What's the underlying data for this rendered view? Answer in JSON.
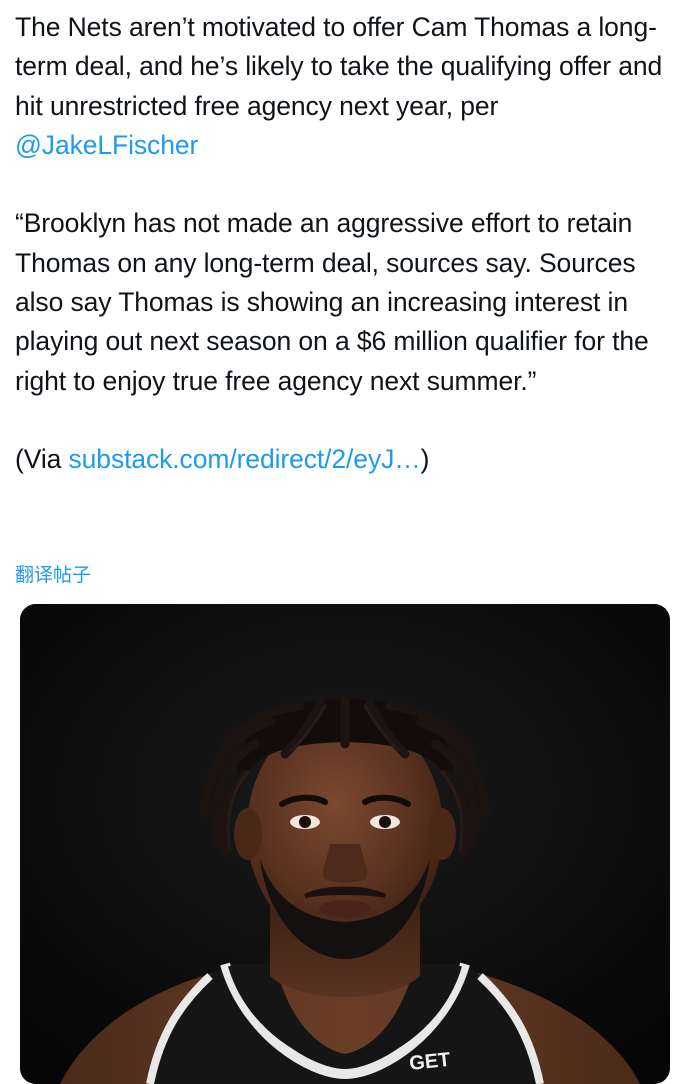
{
  "tweet": {
    "p1_text": "The Nets aren’t motivated to offer Cam Thomas a long-term deal, and he’s likely to take the qualifying offer and hit unrestricted free agency next year, per ",
    "p1_mention": "@JakeLFischer",
    "p2_text": "“Brooklyn has not made an aggressive effort to retain Thomas on any long-term deal, sources say. Sources also say Thomas is showing an increasing interest in playing out next season on a $6 million qualifier for the right to enjoy true free agency next summer.”",
    "p3_prefix": "(Via ",
    "p3_link": "substack.com/redirect/2/eyJ…",
    "p3_suffix": ")"
  },
  "translate_label": "翻译帖子",
  "media": {
    "jersey_text": "GET"
  },
  "colors": {
    "link": "#1d9bf0",
    "text": "#0f1419",
    "media_bg": "#0b0b0b"
  }
}
